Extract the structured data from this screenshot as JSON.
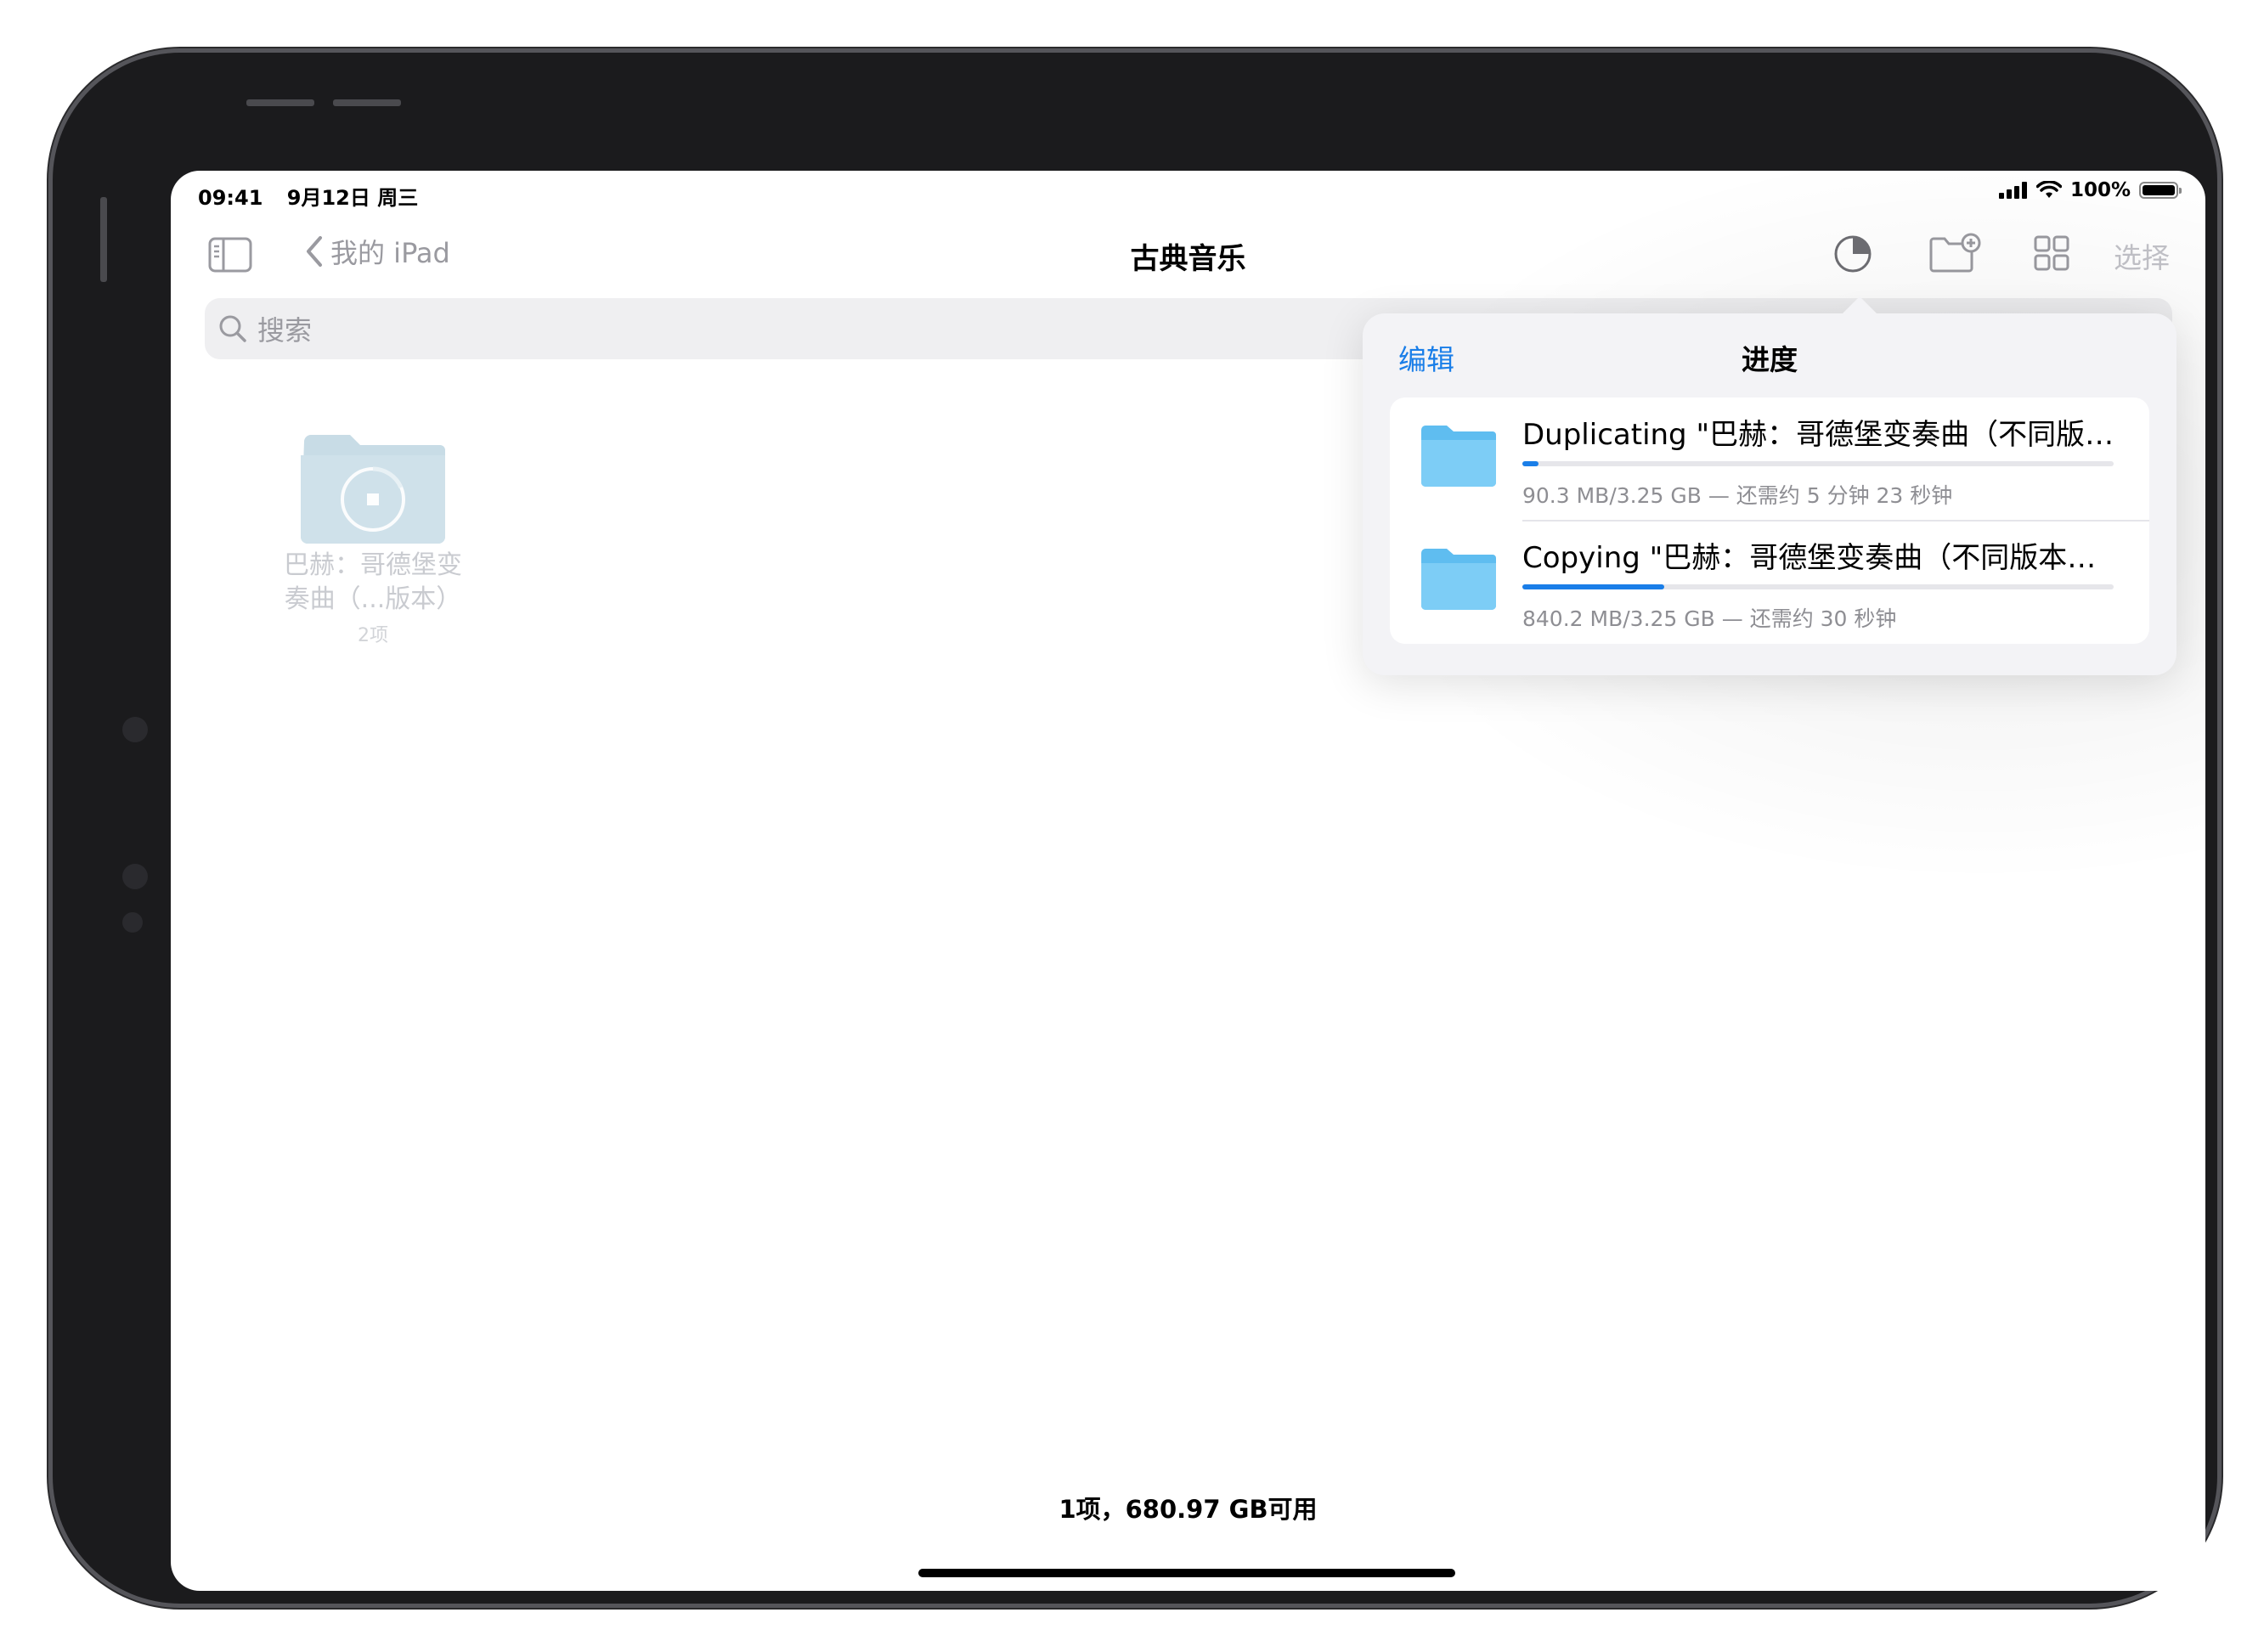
{
  "status_bar": {
    "time": "09:41",
    "date": "9月12日 周三",
    "battery": "100%",
    "icons": [
      "signal-icon",
      "wifi-icon",
      "battery-icon"
    ]
  },
  "nav": {
    "back_label": "我的 iPad",
    "title": "古典音乐",
    "select_label": "选择",
    "icons": [
      "sidebar-icon",
      "chevron-left-icon",
      "progress-pie-icon",
      "new-folder-icon",
      "grid-view-icon"
    ]
  },
  "search": {
    "placeholder": "搜索"
  },
  "folder": {
    "name_line1": "巴赫：哥德堡变",
    "name_line2": "奏曲（...版本）",
    "count": "2项"
  },
  "footer": {
    "summary": "1项，680.97 GB可用"
  },
  "progress_popover": {
    "edit_label": "编辑",
    "title": "进度",
    "items": [
      {
        "name": "Duplicating \"巴赫：哥德堡变奏曲（不同版…",
        "detail": "90.3 MB/3.25 GB — 还需约 5 分钟 23 秒钟",
        "progress": 0.028
      },
      {
        "name": "Copying \"巴赫：哥德堡变奏曲（不同版本…",
        "detail": "840.2 MB/3.25 GB — 还需约 30 秒钟",
        "progress": 0.24
      }
    ]
  },
  "colors": {
    "accent": "#1a7ee8",
    "folder_blue": "#72c8f4",
    "folder_dim": "#c8dce6"
  }
}
